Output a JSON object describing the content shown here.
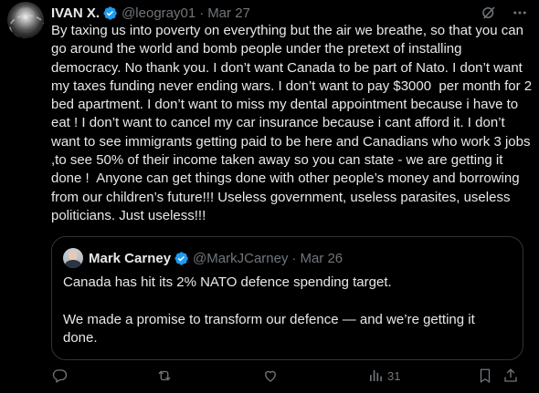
{
  "tweet": {
    "author_name": "IVAN X.",
    "author_handle": "@leogray01",
    "separator": "·",
    "date": "Mar 27",
    "text": "By taxing us into poverty on everything but the air we breathe, so that you can go around the world and bomb people under the pretext of installing democracy. No thank you. I don’t want Canada to be part of Nato. I don’t want my taxes funding never ending wars. I don’t want to pay $3000  per month for 2 bed apartment. I don’t want to miss my dental appointment because i have to eat ! I don’t want to cancel my car insurance because i cant afford it. I don’t want to see immigrants getting paid to be here and Canadians who work 3 jobs ,to see 50% of their income taken away so you can state - we are getting it done !  Anyone can get things done with other people’s money and borrowing from our children’s future!!! Useless government, useless parasites, useless politicians. Just useless!!!"
  },
  "quoted": {
    "author_name": "Mark Carney",
    "author_handle": "@MarkJCarney",
    "separator": "·",
    "date": "Mar 26",
    "text": "Canada has hit its 2% NATO defence spending target.\n\nWe made a promise to transform our defence — and we’re getting it done."
  },
  "actions": {
    "views_count": "31"
  },
  "colors": {
    "background": "#000000",
    "text": "#e7e9ea",
    "muted": "#71767b",
    "verified": "#1d9bf0",
    "border": "#2f3336"
  },
  "icons": [
    "verified-badge-icon",
    "grok-icon",
    "more-icon",
    "reply-icon",
    "retweet-icon",
    "like-icon",
    "views-icon",
    "bookmark-icon",
    "share-icon"
  ]
}
